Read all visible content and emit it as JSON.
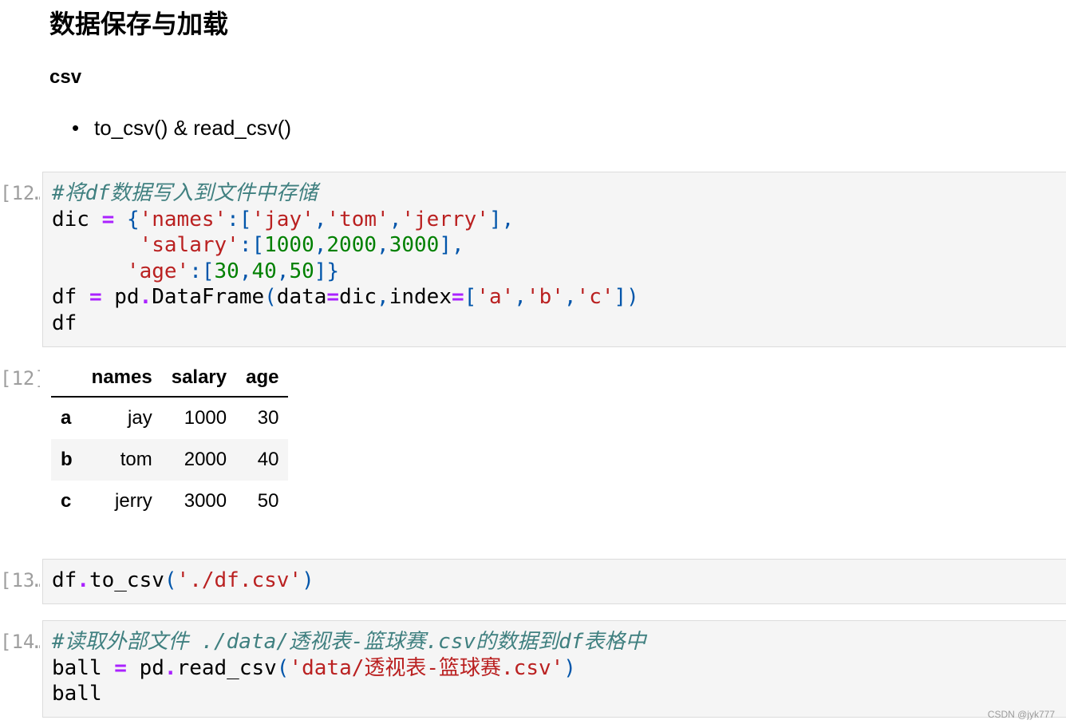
{
  "markdown": {
    "title": "数据保存与加载",
    "subheading": "csv",
    "bullets": [
      "to_csv() & read_csv()"
    ]
  },
  "cells": [
    {
      "prompt": "[12…",
      "lines": [
        [
          [
            "cm",
            "#将df数据写入到文件中存储"
          ]
        ],
        [
          [
            "",
            "dic "
          ],
          [
            "op",
            "="
          ],
          [
            "",
            " "
          ],
          [
            "pn",
            "{"
          ],
          [
            "st",
            "'names'"
          ],
          [
            "pn",
            ":["
          ],
          [
            "st",
            "'jay'"
          ],
          [
            "pn",
            ","
          ],
          [
            "st",
            "'tom'"
          ],
          [
            "pn",
            ","
          ],
          [
            "st",
            "'jerry'"
          ],
          [
            "pn",
            "],"
          ]
        ],
        [
          [
            "",
            "       "
          ],
          [
            "st",
            "'salary'"
          ],
          [
            "pn",
            ":["
          ],
          [
            "nu",
            "1000"
          ],
          [
            "pn",
            ","
          ],
          [
            "nu",
            "2000"
          ],
          [
            "pn",
            ","
          ],
          [
            "nu",
            "3000"
          ],
          [
            "pn",
            "],"
          ]
        ],
        [
          [
            "",
            "      "
          ],
          [
            "st",
            "'age'"
          ],
          [
            "pn",
            ":["
          ],
          [
            "nu",
            "30"
          ],
          [
            "pn",
            ","
          ],
          [
            "nu",
            "40"
          ],
          [
            "pn",
            ","
          ],
          [
            "nu",
            "50"
          ],
          [
            "pn",
            "]}"
          ]
        ],
        [
          [
            "",
            "df "
          ],
          [
            "op",
            "="
          ],
          [
            "",
            " pd"
          ],
          [
            "op",
            "."
          ],
          [
            "",
            "DataFrame"
          ],
          [
            "pn",
            "("
          ],
          [
            "",
            "data"
          ],
          [
            "op",
            "="
          ],
          [
            "",
            "dic"
          ],
          [
            "pn",
            ","
          ],
          [
            "",
            "index"
          ],
          [
            "op",
            "="
          ],
          [
            "pn",
            "["
          ],
          [
            "st",
            "'a'"
          ],
          [
            "pn",
            ","
          ],
          [
            "st",
            "'b'"
          ],
          [
            "pn",
            ","
          ],
          [
            "st",
            "'c'"
          ],
          [
            "pn",
            "])"
          ]
        ],
        [
          [
            "",
            "df"
          ]
        ]
      ]
    },
    {
      "prompt": "[13…",
      "lines": [
        [
          [
            "",
            "df"
          ],
          [
            "op",
            "."
          ],
          [
            "",
            "to_csv"
          ],
          [
            "pn",
            "("
          ],
          [
            "st",
            "'./df.csv'"
          ],
          [
            "pn",
            ")"
          ]
        ]
      ]
    },
    {
      "prompt": "[14…",
      "lines": [
        [
          [
            "cm",
            "#读取外部文件 ./data/透视表-篮球赛.csv的数据到df表格中"
          ]
        ],
        [
          [
            "",
            "ball "
          ],
          [
            "op",
            "="
          ],
          [
            "",
            " pd"
          ],
          [
            "op",
            "."
          ],
          [
            "",
            "read_csv"
          ],
          [
            "pn",
            "("
          ],
          [
            "st",
            "'data/透视表-篮球赛.csv'"
          ],
          [
            "pn",
            ")"
          ]
        ],
        [
          [
            "",
            "ball"
          ]
        ]
      ]
    }
  ],
  "output": {
    "prompt": "[12]:",
    "columns": [
      "names",
      "salary",
      "age"
    ],
    "rows": [
      {
        "index": "a",
        "values": [
          "jay",
          "1000",
          "30"
        ]
      },
      {
        "index": "b",
        "values": [
          "tom",
          "2000",
          "40"
        ]
      },
      {
        "index": "c",
        "values": [
          "jerry",
          "3000",
          "50"
        ]
      }
    ]
  },
  "watermark": "CSDN @jyk777",
  "colors": {
    "comment": "#408080",
    "operator": "#aa22ff",
    "string": "#ba2121",
    "number": "#008000",
    "punctuation": "#0055aa",
    "cell_background": "#f5f5f5",
    "prompt": "#9e9e9e"
  }
}
